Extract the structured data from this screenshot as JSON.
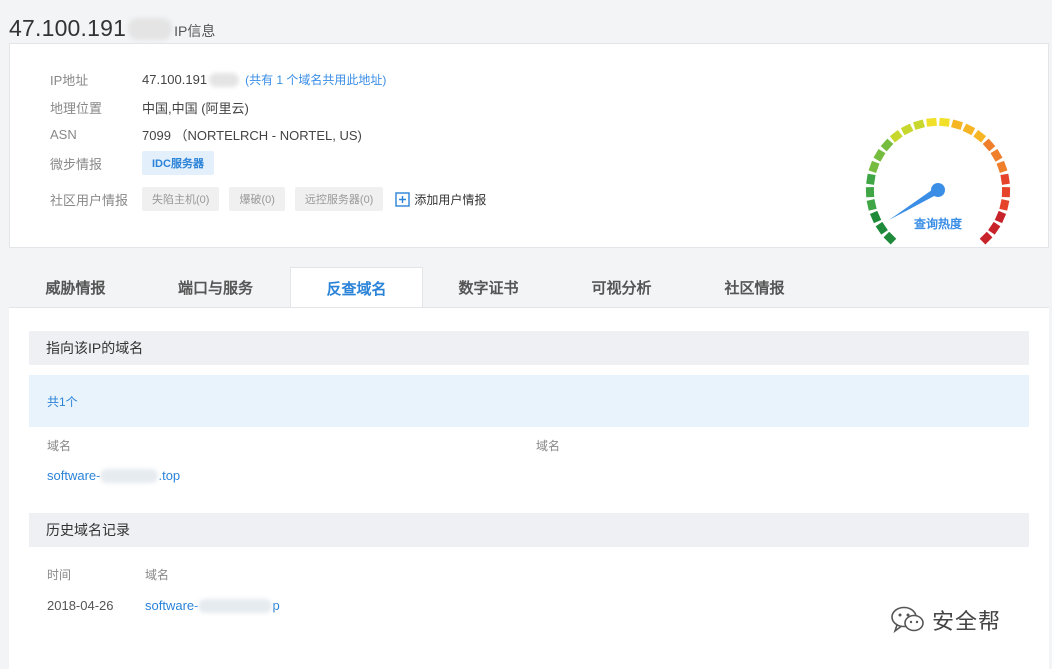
{
  "page": {
    "title_ip": "47.100.191",
    "title_suffix": "IP信息"
  },
  "info": {
    "ip_label": "IP地址",
    "ip_value": "47.100.191",
    "ip_shared": "(共有 1 个域名共用此地址)",
    "geo_label": "地理位置",
    "geo_value": "中国,中国 (阿里云)",
    "asn_label": "ASN",
    "asn_value": "7099 （NORTELRCH - NORTEL, US)",
    "wb_label": "微步情报",
    "wb_tag": "IDC服务器",
    "community_label": "社区用户情报",
    "community_tags": [
      "失陷主机(0)",
      "爆破(0)",
      "远控服务器(0)"
    ],
    "add_intel": "添加用户情报"
  },
  "gauge": {
    "label": "查询热度",
    "level": 0.05,
    "colors": [
      "#1e8a3a",
      "#3fa545",
      "#76bd3f",
      "#c8d72e",
      "#f1e02a",
      "#f6b524",
      "#ef7f2a",
      "#e5432a",
      "#c8222a"
    ]
  },
  "tabs": [
    "威胁情报",
    "端口与服务",
    "反查域名",
    "数字证书",
    "可视分析",
    "社区情报"
  ],
  "active_tab": "反查域名",
  "reverse": {
    "section_title": "指向该IP的域名",
    "count": "共1个",
    "col1": "域名",
    "col2": "域名",
    "domain_prefix": "software-",
    "domain_suffix": ".top"
  },
  "history": {
    "section_title": "历史域名记录",
    "col_time": "时间",
    "col_domain": "域名",
    "rows": [
      {
        "date": "2018-04-26",
        "domain_prefix": "software-",
        "domain_suffix": "p"
      }
    ]
  },
  "watermark": "安全帮"
}
